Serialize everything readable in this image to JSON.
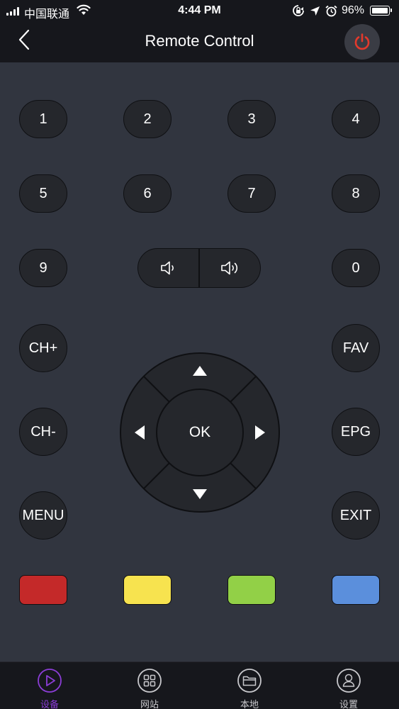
{
  "status_bar": {
    "carrier": "中国联通",
    "time": "4:44 PM",
    "battery": "96%"
  },
  "nav": {
    "title": "Remote Control",
    "back_icon": "chevron-left-icon",
    "power_icon": "power-icon",
    "power_color": "#e4392b"
  },
  "keypad": {
    "digits": [
      "1",
      "2",
      "3",
      "4",
      "5",
      "6",
      "7",
      "8",
      "9",
      "0"
    ]
  },
  "volume": {
    "down_icon": "volume-down-icon",
    "up_icon": "volume-up-icon"
  },
  "side_buttons": {
    "ch_up": "CH+",
    "ch_down": "CH-",
    "menu": "MENU",
    "fav": "FAV",
    "epg": "EPG",
    "exit": "EXIT"
  },
  "dpad": {
    "ok": "OK"
  },
  "color_buttons": {
    "red": "#c42929",
    "yellow": "#f7e34f",
    "green": "#92d047",
    "blue": "#5b8fdc"
  },
  "tabs": [
    {
      "label": "设备",
      "icon": "play-circle-icon",
      "active": true
    },
    {
      "label": "网站",
      "icon": "grid-circle-icon",
      "active": false
    },
    {
      "label": "本地",
      "icon": "folder-circle-icon",
      "active": false
    },
    {
      "label": "设置",
      "icon": "user-circle-icon",
      "active": false
    }
  ],
  "colors": {
    "accent": "#8b3dd6",
    "background": "#31353f",
    "bar": "#16171c",
    "button": "#25272c"
  }
}
